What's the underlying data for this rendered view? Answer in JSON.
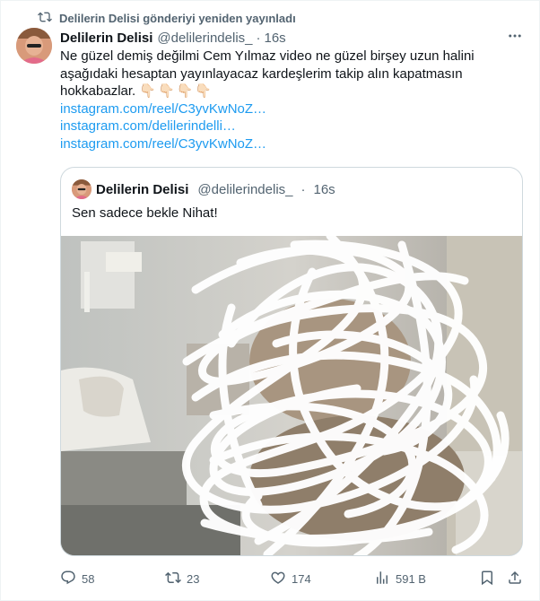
{
  "repost": {
    "text": "Delilerin Delisi gönderiyi yeniden yayınladı",
    "icon": "repost-icon"
  },
  "tweet": {
    "display_name": "Delilerin Delisi",
    "handle": "@delilerindelis_",
    "separator": "·",
    "time": "16s",
    "text": "Ne güzel demiş değilmi Cem Yılmaz video ne güzel birşey uzun halini aşağıdaki hesaptan yayınlayacaz kardeşlerim takip alın kapatmasın hokkabazlar.",
    "emojis": "👇🏻👇🏻👇🏻👇🏻",
    "links": [
      "instagram.com/reel/C3yvKwNoZ…",
      "instagram.com/delilerindelli…",
      "instagram.com/reel/C3yvKwNoZ…"
    ]
  },
  "quote": {
    "display_name": "Delilerin Delisi",
    "handle": "@delilerindelis_",
    "separator": "·",
    "time": "16s",
    "text": "Sen sadece bekle Nihat!"
  },
  "actions": {
    "replies": "58",
    "reposts": "23",
    "likes": "174",
    "views": "591 B"
  },
  "colors": {
    "link": "#1d9bf0",
    "secondary_text": "#536471",
    "border": "#cfd9de"
  }
}
